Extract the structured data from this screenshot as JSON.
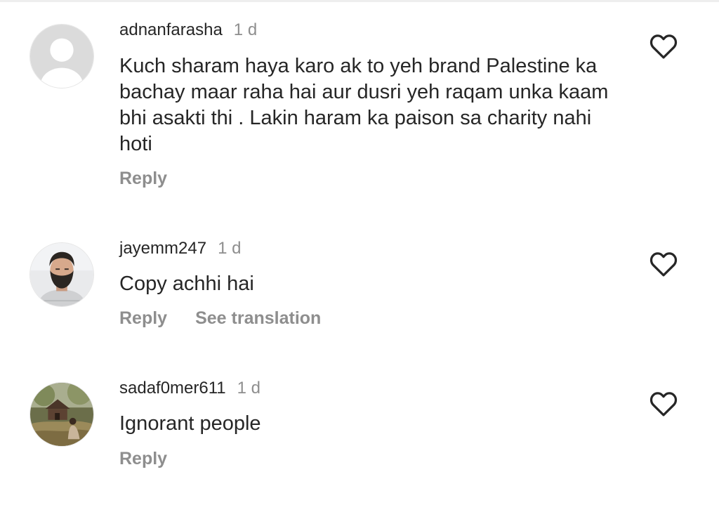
{
  "comments": [
    {
      "username": "adnanfarasha",
      "time": "1 d",
      "text": "Kuch sharam haya karo ak to yeh brand Palestine ka bachay maar raha hai aur dusri yeh raqam unka kaam bhi asakti thi . Lakin haram ka paison sa charity nahi hoti",
      "reply_label": "Reply",
      "avatar_icon": "default-avatar-icon",
      "like_icon": "heart-outline-icon"
    },
    {
      "username": "jayemm247",
      "time": "1 d",
      "text": "Copy achhi hai",
      "reply_label": "Reply",
      "see_translation_label": "See translation",
      "avatar_icon": "profile-photo",
      "like_icon": "heart-outline-icon"
    },
    {
      "username": "sadaf0mer611",
      "time": "1 d",
      "text": "Ignorant people",
      "reply_label": "Reply",
      "avatar_icon": "profile-photo",
      "like_icon": "heart-outline-icon"
    }
  ],
  "colors": {
    "primary_text": "#262626",
    "secondary_text": "#8e8e8e",
    "background": "#ffffff"
  }
}
